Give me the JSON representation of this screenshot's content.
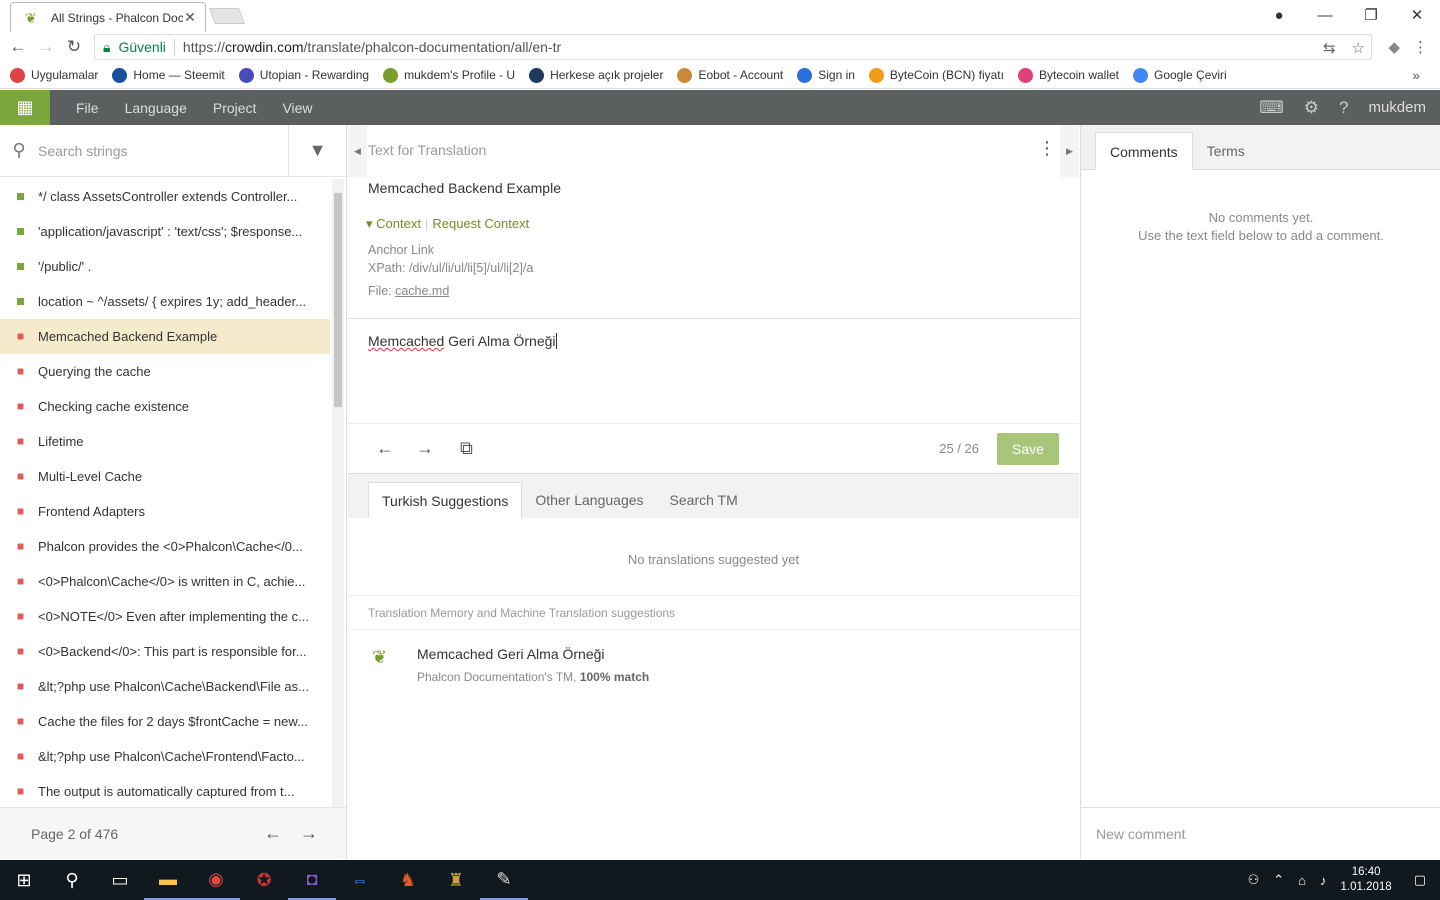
{
  "browser": {
    "tab_title": "All Strings - Phalcon Doc",
    "secure_label": "Güvenli",
    "url_prefix": "https://",
    "url_host": "crowdin.com",
    "url_path": "/translate/phalcon-documentation/all/en-tr",
    "bookmarks": [
      {
        "label": "Uygulamalar",
        "icon": "apps-grid-icon",
        "color": "#d44"
      },
      {
        "label": "Home — Steemit",
        "icon": "steemit-icon",
        "color": "#1a5099"
      },
      {
        "label": "Utopian - Rewarding",
        "icon": "utopian-icon",
        "color": "#4a4ab8"
      },
      {
        "label": "mukdem's Profile - U",
        "icon": "crowdin-icon",
        "color": "#7a9e2b"
      },
      {
        "label": "Herkese açık projeler",
        "icon": "transifex-icon",
        "color": "#1f3a5f"
      },
      {
        "label": "Eobot - Account",
        "icon": "eobot-icon",
        "color": "#c98b3a"
      },
      {
        "label": "Sign in",
        "icon": "signin-icon",
        "color": "#2a6fdb"
      },
      {
        "label": "ByteCoin (BCN) fiyatı",
        "icon": "bitcoin-icon",
        "color": "#f29b1a"
      },
      {
        "label": "Bytecoin wallet",
        "icon": "bytecoin-icon",
        "color": "#e0407a"
      },
      {
        "label": "Google Çeviri",
        "icon": "google-translate-icon",
        "color": "#4285f4"
      }
    ]
  },
  "topbar": {
    "menu": [
      "File",
      "Language",
      "Project",
      "View"
    ],
    "username": "mukdem"
  },
  "left": {
    "search_placeholder": "Search strings",
    "strings": [
      {
        "text": "*/ class AssetsController extends Controller...",
        "status": "done"
      },
      {
        "text": "'application/javascript' : 'text/css'; $response...",
        "status": "done"
      },
      {
        "text": "'/public/' .",
        "status": "done"
      },
      {
        "text": "location ~ ^/assets/ { expires 1y; add_header...",
        "status": "done"
      },
      {
        "text": "Memcached Backend Example",
        "status": "todo",
        "selected": true
      },
      {
        "text": "Querying the cache",
        "status": "todo"
      },
      {
        "text": "Checking cache existence",
        "status": "todo"
      },
      {
        "text": "Lifetime",
        "status": "todo"
      },
      {
        "text": "Multi-Level Cache",
        "status": "todo"
      },
      {
        "text": "Frontend Adapters",
        "status": "todo"
      },
      {
        "text": "Phalcon provides the <0>Phalcon\\Cache</0...",
        "status": "todo"
      },
      {
        "text": "<0>Phalcon\\Cache</0> is written in C, achie...",
        "status": "todo"
      },
      {
        "text": "<0>NOTE</0> Even after implementing the c...",
        "status": "todo"
      },
      {
        "text": "<0>Backend</0>: This part is responsible for...",
        "status": "todo"
      },
      {
        "text": "&lt;?php use Phalcon\\Cache\\Backend\\File as...",
        "status": "todo"
      },
      {
        "text": "Cache the files for 2 days $frontCache = new...",
        "status": "todo"
      },
      {
        "text": "&lt;?php use Phalcon\\Cache\\Frontend\\Facto...",
        "status": "todo"
      },
      {
        "text": "The output is automatically captured from t...",
        "status": "todo"
      }
    ],
    "pager": "Page 2 of 476"
  },
  "center": {
    "header": "Text for Translation",
    "source_text": "Memcached Backend Example",
    "context_label": "Context",
    "request_context": "Request Context",
    "anchor": "Anchor Link",
    "xpath": "XPath: /div/ul/li/ul/li[5]/ul/li[2]/a",
    "file_label": "File: ",
    "file_name": "cache.md",
    "translation_misspelled": "Memcached",
    "translation_rest": " Geri Alma Örneği",
    "counter": "25 / 26",
    "save_label": "Save",
    "tabs": [
      "Turkish Suggestions",
      "Other Languages",
      "Search TM"
    ],
    "no_suggestions": "No translations suggested yet",
    "tm_header": "Translation Memory and Machine Translation suggestions",
    "tm_text": "Memcached Geri Alma Örneği",
    "tm_source": "Phalcon Documentation's TM, ",
    "tm_match": "100% match"
  },
  "right": {
    "tabs": [
      "Comments",
      "Terms"
    ],
    "no_comments_1": "No comments yet.",
    "no_comments_2": "Use the text field below to add a comment.",
    "new_comment_placeholder": "New comment"
  },
  "taskbar": {
    "time": "16:40",
    "date": "1.01.2018"
  }
}
